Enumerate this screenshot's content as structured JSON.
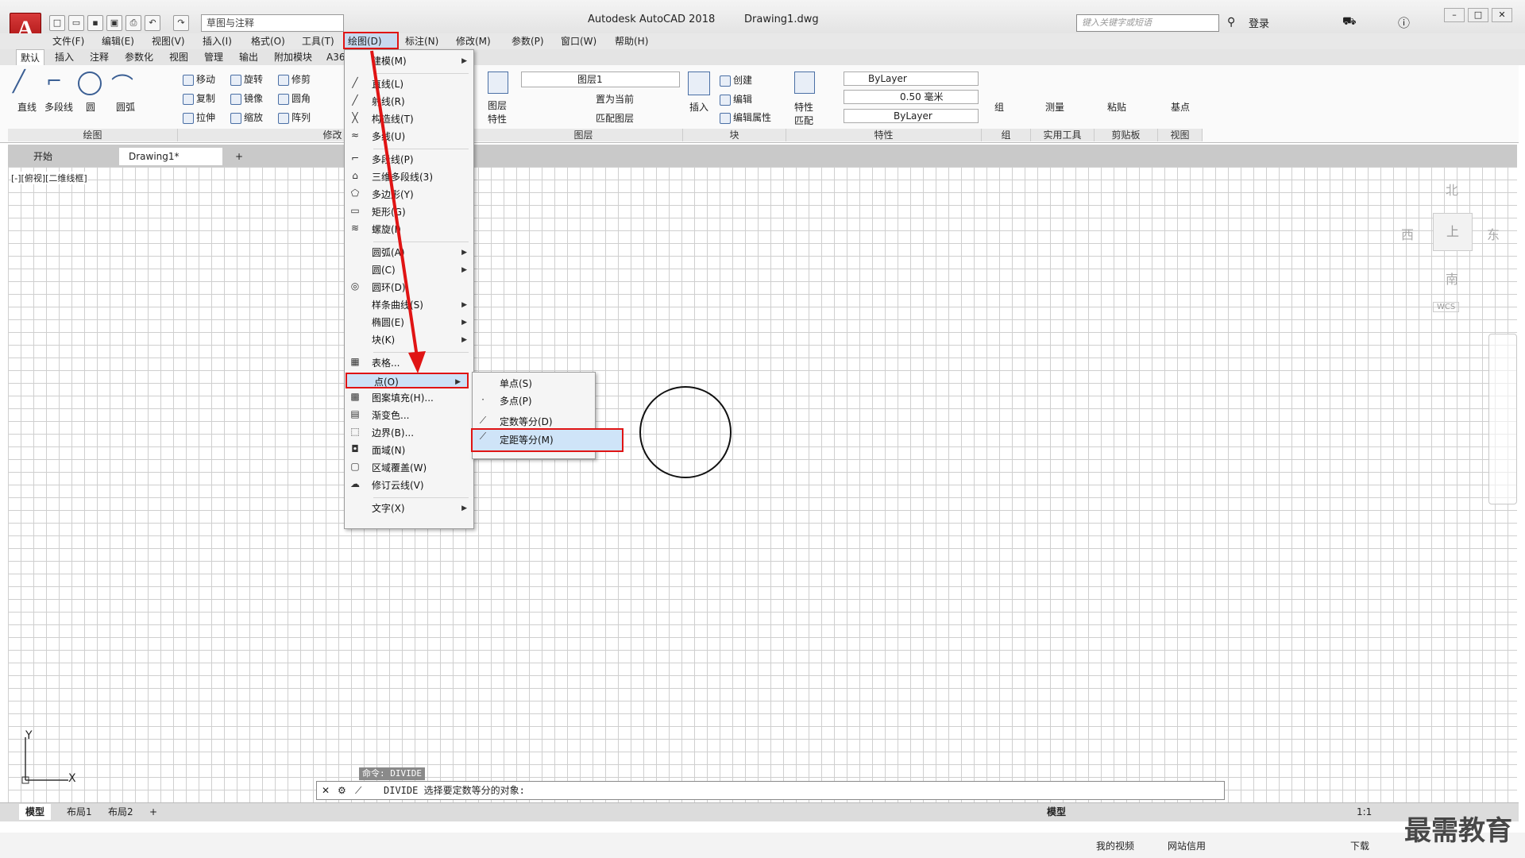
{
  "window": {
    "app_title": "Autodesk AutoCAD 2018",
    "file": "Drawing1.dwg",
    "workspace": "草图与注释",
    "search_placeholder": "键入关键字或短语",
    "login": "登录",
    "app_letter": "A"
  },
  "menubar": [
    "文件(F)",
    "编辑(E)",
    "视图(V)",
    "插入(I)",
    "格式(O)",
    "工具(T)",
    "绘图(D)",
    "标注(N)",
    "修改(M)",
    "参数(P)",
    "窗口(W)",
    "帮助(H)"
  ],
  "ribbon_tabs": [
    "默认",
    "插入",
    "注释",
    "参数化",
    "视图",
    "管理",
    "输出",
    "附加模块",
    "A36"
  ],
  "ribbon": {
    "draw_tools": [
      "直线",
      "多段线",
      "圆",
      "圆弧"
    ],
    "modify": [
      "移动",
      "旋转",
      "修剪",
      "复制",
      "镜像",
      "圆角",
      "拉伸",
      "缩放",
      "阵列"
    ],
    "layer_name": "图层1",
    "layer_btns": [
      "图层特性",
      "置为当前",
      "匹配图层"
    ],
    "block": [
      "插入",
      "创建",
      "编辑",
      "编辑属性"
    ],
    "properties": {
      "match": "特性匹配",
      "color": "ByLayer",
      "lineweight": "0.50 毫米",
      "linetype": "ByLayer"
    },
    "group": "组",
    "utilities": "测量",
    "clipboard": "粘贴",
    "basepoint": "基点",
    "panels": [
      "绘图",
      "修改",
      "图层",
      "块",
      "特性",
      "组",
      "实用工具",
      "剪贴板",
      "视图"
    ]
  },
  "doc_tabs": [
    "开始",
    "Drawing1*",
    "+"
  ],
  "view_label": "[-][俯视][二维线框]",
  "draw_menu": [
    {
      "label": "建模(M)",
      "sub": true
    },
    {
      "sep": true
    },
    {
      "label": "直线(L)",
      "icon": "╱"
    },
    {
      "label": "射线(R)",
      "icon": "╱"
    },
    {
      "label": "构造线(T)",
      "icon": "╳"
    },
    {
      "label": "多线(U)",
      "icon": "≈"
    },
    {
      "sep": true
    },
    {
      "label": "多段线(P)",
      "icon": "⌐"
    },
    {
      "label": "三维多段线(3)",
      "icon": "⌂"
    },
    {
      "label": "多边形(Y)",
      "icon": "⬠"
    },
    {
      "label": "矩形(G)",
      "icon": "▭"
    },
    {
      "label": "螺旋(I)",
      "icon": "≋"
    },
    {
      "sep": true
    },
    {
      "label": "圆弧(A)",
      "sub": true
    },
    {
      "label": "圆(C)",
      "sub": true
    },
    {
      "label": "圆环(D)",
      "icon": "◎"
    },
    {
      "label": "样条曲线(S)",
      "sub": true
    },
    {
      "label": "椭圆(E)",
      "sub": true
    },
    {
      "label": "块(K)",
      "sub": true
    },
    {
      "sep": true
    },
    {
      "label": "表格...",
      "icon": "▦"
    },
    {
      "label": "点(O)",
      "sub": true,
      "highlight": true
    },
    {
      "label": "图案填充(H)...",
      "icon": "▩"
    },
    {
      "label": "渐变色...",
      "icon": "▤"
    },
    {
      "label": "边界(B)...",
      "icon": "⬚"
    },
    {
      "label": "面域(N)",
      "icon": "◘"
    },
    {
      "label": "区域覆盖(W)",
      "icon": "▢"
    },
    {
      "label": "修订云线(V)",
      "icon": "☁"
    },
    {
      "sep": true
    },
    {
      "label": "文字(X)",
      "sub": true
    }
  ],
  "point_submenu": [
    {
      "label": "单点(S)"
    },
    {
      "label": "多点(P)",
      "icon": "·"
    },
    {
      "label": "定数等分(D)",
      "icon": "⟋"
    },
    {
      "label": "定距等分(M)",
      "icon": "⟋",
      "highlight": true
    }
  ],
  "compass": {
    "n": "北",
    "s": "南",
    "e": "东",
    "w": "西",
    "top": "上",
    "wcs": "WCS"
  },
  "ucs": {
    "x": "X",
    "y": "Y"
  },
  "command": {
    "history": "命令: DIVIDE",
    "prompt": "DIVIDE 选择要定数等分的对象:"
  },
  "layout_tabs": [
    "模型",
    "布局1",
    "布局2",
    "+"
  ],
  "status": {
    "model": "模型",
    "scale": "1:1"
  },
  "taskbar": [
    "我的视频",
    "网站信用",
    "下载"
  ],
  "watermark": "最需教育",
  "annotation_color": "#e01414"
}
